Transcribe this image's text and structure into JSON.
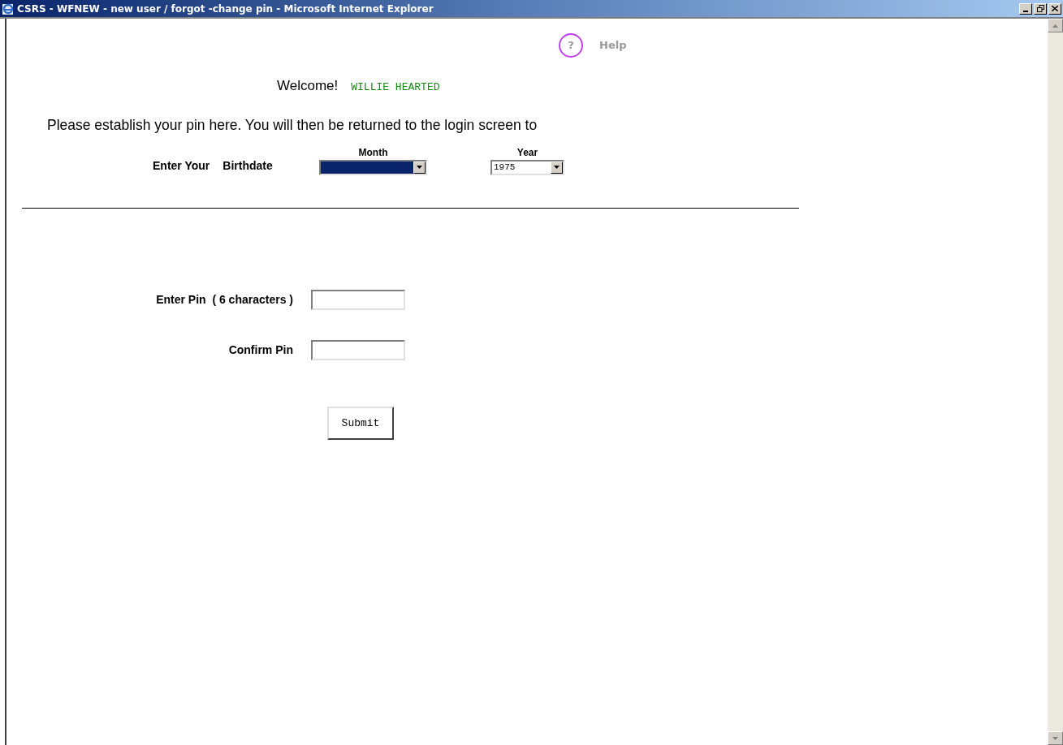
{
  "window": {
    "title": "CSRS - WFNEW - new user / forgot -change pin - Microsoft Internet Explorer"
  },
  "help": {
    "icon_text": "?",
    "label": "Help"
  },
  "welcome": {
    "label": "Welcome!",
    "name": "WILLIE HEARTED"
  },
  "instructions": "Please establish your pin here. You will then be returned to the login screen to",
  "birthdate": {
    "label_1": "Enter Your",
    "label_2": "Birthdate",
    "month": {
      "label": "Month"
    },
    "year": {
      "label": "Year",
      "value": "1975"
    }
  },
  "pin_fields": [
    {
      "label": "Enter Pin  ( 6 characters )"
    },
    {
      "label": "Confirm Pin"
    }
  ],
  "submit": "Submit"
}
